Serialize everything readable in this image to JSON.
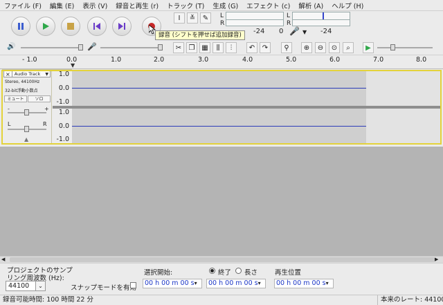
{
  "menu": [
    "ファイル (F)",
    "編集 (E)",
    "表示 (V)",
    "録音と再生 (r)",
    "トラック (T)",
    "生成 (G)",
    "エフェクト (c)",
    "解析 (A)",
    "ヘルプ (H)"
  ],
  "transport": {
    "pause": "pause-icon",
    "play": "play-icon",
    "stop": "stop-icon",
    "skip_start": "skip-start-icon",
    "skip_end": "skip-end-icon",
    "record": "record-icon"
  },
  "tooltip": "録音 (シフトを押せば追加録音)",
  "meters": {
    "play_label": "L",
    "play_label2": "R",
    "rec_label": "L",
    "rec_label2": "R",
    "db_left": "-24",
    "zero": "0",
    "db_right": "-24"
  },
  "ruler": [
    "- 1.0",
    "0.0",
    "1.0",
    "2.0",
    "3.0",
    "4.0",
    "5.0",
    "6.0",
    "7.0",
    "8.0"
  ],
  "track": {
    "name": "Audio Track",
    "info1": "Stereo, 44100Hz",
    "info2": "32-bit浮動小数点",
    "mute": "ミュート",
    "solo": "ソロ",
    "gain_minus": "-",
    "gain_plus": "+",
    "pan_left": "L",
    "pan_right": "R"
  },
  "scale": {
    "top": [
      "1.0",
      "0.0",
      "-1.0"
    ],
    "bottom": [
      "1.0",
      "0.0",
      "-1.0"
    ]
  },
  "bottom": {
    "rate_label_line1": "プロジェクトのサンプ",
    "rate_label_line2": "リング周波数 (Hz):",
    "rate_value": "44100",
    "snap_label": "スナップモードを有効",
    "sel_start_label": "選択開始:",
    "radio_end": "終了",
    "radio_length": "長さ",
    "playpos_label": "再生位置",
    "time1": "00 h 00 m 00 s",
    "time2": "00 h 00 m 00 s",
    "time3": "00 h 00 m 00 s"
  },
  "status": {
    "left": "録音可能時間: 100 時間 22 分",
    "right": "本来のレート: 44100"
  },
  "colors": {
    "waveform": "#2b3bb8",
    "selection_frame": "#e3d23a",
    "time_digits": "#1b36c6"
  }
}
